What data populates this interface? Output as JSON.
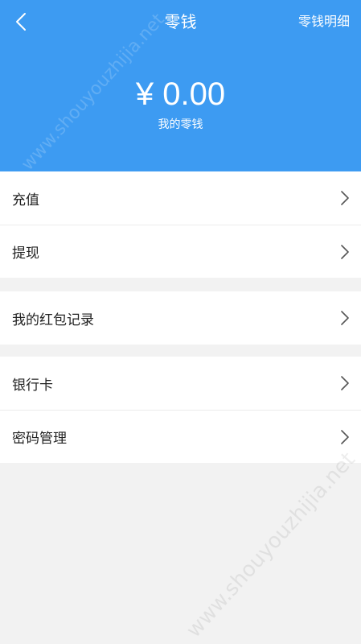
{
  "nav": {
    "title": "零钱",
    "detail_link": "零钱明细",
    "back_icon": "chevron-left-icon"
  },
  "wallet": {
    "balance": "¥ 0.00",
    "label": "我的零钱"
  },
  "groups": [
    {
      "items": [
        {
          "label": "充值"
        },
        {
          "label": "提现"
        }
      ]
    },
    {
      "items": [
        {
          "label": "我的红包记录"
        }
      ]
    },
    {
      "items": [
        {
          "label": "银行卡"
        },
        {
          "label": "密码管理"
        }
      ]
    }
  ],
  "watermark": "www.shouyouzhijia.net",
  "colors": {
    "header_bg": "#3d9bf2",
    "page_bg": "#f2f2f2",
    "row_bg": "#ffffff"
  }
}
